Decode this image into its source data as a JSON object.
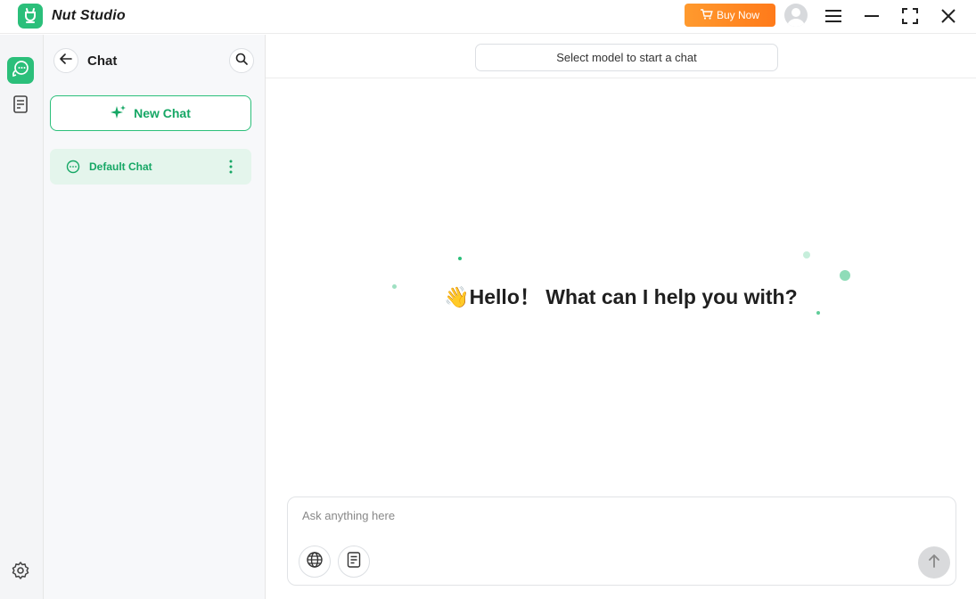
{
  "app": {
    "title": "Nut Studio"
  },
  "titlebar": {
    "buy_label": "Buy Now"
  },
  "colors": {
    "accent": "#2bbf7a",
    "accent_text": "#16a765",
    "buy": "#ff8a24"
  },
  "icons": {
    "logo": "nut-logo-icon",
    "cart": "cart-icon",
    "avatar": "user-avatar-icon",
    "menu": "hamburger-menu-icon",
    "minimize": "minimize-icon",
    "maximize": "fullscreen-icon",
    "close": "close-icon",
    "chat": "chat-bubbles-icon",
    "knowledge": "document-icon",
    "settings": "gear-icon",
    "back": "arrow-left-icon",
    "search": "search-icon",
    "sparkle": "sparkle-icon",
    "more": "more-vertical-icon",
    "globe": "globe-icon",
    "attach": "document-icon",
    "send": "arrow-up-icon"
  },
  "sidebar": {
    "title": "Chat",
    "new_chat_label": "New Chat",
    "chats": [
      {
        "label": "Default Chat",
        "active": true
      }
    ]
  },
  "main": {
    "model_select_label": "Select model to start a chat",
    "greeting_emoji": "👋",
    "greeting": "Hello！ What can I help you with?",
    "composer": {
      "placeholder": "Ask anything here",
      "value": ""
    }
  }
}
